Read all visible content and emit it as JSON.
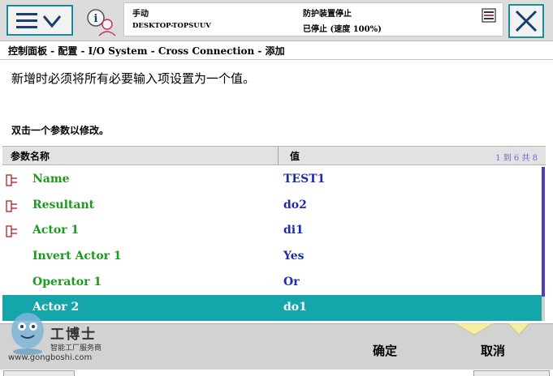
{
  "header": {
    "mode": "手动",
    "controller": "DESKTOP-TOPSUUV",
    "state": "防护装置停止",
    "speed_status": "已停止 (速度 100%)"
  },
  "breadcrumb": "控制面板 - 配置 - I/O System - Cross Connection - 添加",
  "instruction": "新增时必须将所有必要输入项设置为一个值。",
  "hint": "双击一个参数以修改。",
  "table": {
    "col_name": "参数名称",
    "col_value": "值",
    "count": "1 到 6 共 8",
    "rows": [
      {
        "name": "Name",
        "value": "TEST1",
        "required": true
      },
      {
        "name": "Resultant",
        "value": "do2",
        "required": true
      },
      {
        "name": "Actor 1",
        "value": "di1",
        "required": true
      },
      {
        "name": "Invert Actor 1",
        "value": "Yes",
        "required": false
      },
      {
        "name": "Operator 1",
        "value": "Or",
        "required": false
      },
      {
        "name": "Actor 2",
        "value": "do1",
        "required": false,
        "selected": true
      }
    ]
  },
  "footer": {
    "ok_label": "确定",
    "cancel_label": "取消"
  },
  "watermark": {
    "brand": "工博士",
    "tagline": "智能工厂服务商",
    "url": "www.gongboshi.com"
  },
  "colors": {
    "accent": "#15a6ac",
    "param_name": "#1c9a1c",
    "param_value": "#1c2ab0",
    "scroll": "#4a3fb4"
  },
  "icons": {
    "menu": "hamburger-chevron-icon",
    "status": "operator-info-icon",
    "log": "event-log-icon",
    "close": "close-icon",
    "required": "required-param-icon"
  }
}
